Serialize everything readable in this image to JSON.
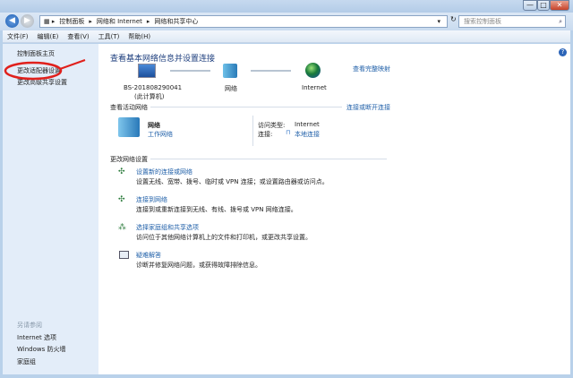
{
  "window": {
    "minimize": "—",
    "maximize": "□",
    "close": "✕"
  },
  "address": {
    "crumbs": [
      "控制面板",
      "网络和 Internet",
      "网络和共享中心"
    ],
    "search_placeholder": "搜索控制面板"
  },
  "menu": [
    "文件(F)",
    "编辑(E)",
    "查看(V)",
    "工具(T)",
    "帮助(H)"
  ],
  "sidebar": {
    "items": [
      "控制面板主页",
      "更改适配器设置",
      "更改高级共享设置"
    ],
    "see_also": "另请参阅",
    "see_also_items": [
      "Internet 选项",
      "Windows 防火墙",
      "家庭组"
    ]
  },
  "main": {
    "title": "查看基本网络信息并设置连接",
    "map_link": "查看完整映射",
    "map": {
      "computer": "BS-201808290041",
      "computer_sub": "(此计算机)",
      "network": "网络",
      "internet": "Internet"
    },
    "active_header": "查看活动网络",
    "connect_link": "连接或断开连接",
    "active": {
      "name": "网络",
      "type": "工作网络",
      "access_label": "访问类型:",
      "access_value": "Internet",
      "conn_label": "连接:",
      "conn_value": "本地连接"
    },
    "change_header": "更改网络设置",
    "tasks": [
      {
        "title": "设置新的连接或网络",
        "desc": "设置无线、宽带、拨号、临时或 VPN 连接；或设置路由器或访问点。"
      },
      {
        "title": "连接到网络",
        "desc": "连接到或重新连接到无线、有线、拨号或 VPN 网络连接。"
      },
      {
        "title": "选择家庭组和共享选项",
        "desc": "访问位于其他网络计算机上的文件和打印机，或更改共享设置。"
      },
      {
        "title": "疑难解答",
        "desc": "诊断并修复网络问题，或获得故障排除信息。"
      }
    ]
  },
  "colors": {
    "highlight": "#e0201c",
    "link": "#1f5fa8"
  }
}
